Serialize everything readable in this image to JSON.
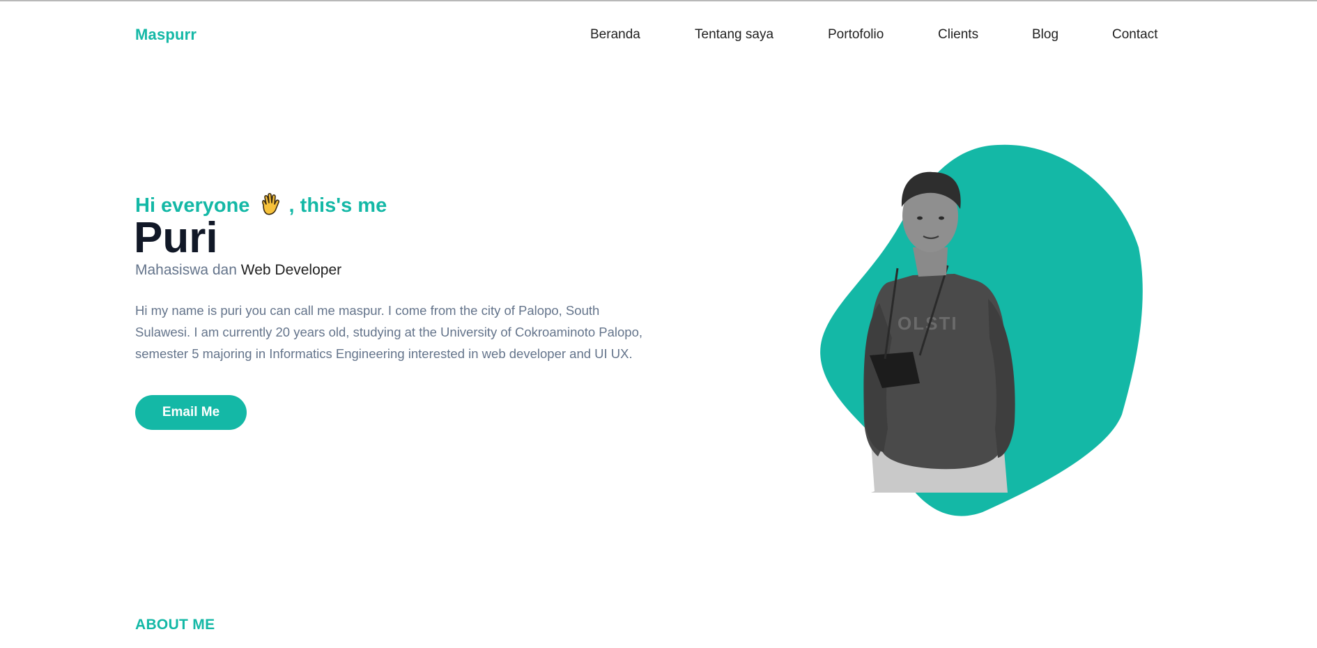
{
  "brand": {
    "logo_text": "Maspurr",
    "accent_color": "#14b8a6"
  },
  "nav": {
    "items": [
      {
        "label": "Beranda"
      },
      {
        "label": "Tentang saya"
      },
      {
        "label": "Portofolio"
      },
      {
        "label": "Clients"
      },
      {
        "label": "Blog"
      },
      {
        "label": "Contact"
      }
    ]
  },
  "hero": {
    "greeting_pre": "Hi everyone",
    "greeting_icon": "waving-hand-icon",
    "greeting_post": ", this's me",
    "name": "Puri",
    "role_prefix": "Mahasiswa dan",
    "role_highlight": "Web Developer",
    "bio": "Hi my name is puri you can call me maspur. I come from the city of Palopo, South Sulawesi. I am currently 20 years old, studying at the University of Cokroaminoto Palopo, semester 5 majoring in Informatics Engineering interested in web developer and UI UX.",
    "cta_label": "Email Me",
    "photo_icon": "profile-photo"
  },
  "about": {
    "heading": "ABOUT ME"
  }
}
